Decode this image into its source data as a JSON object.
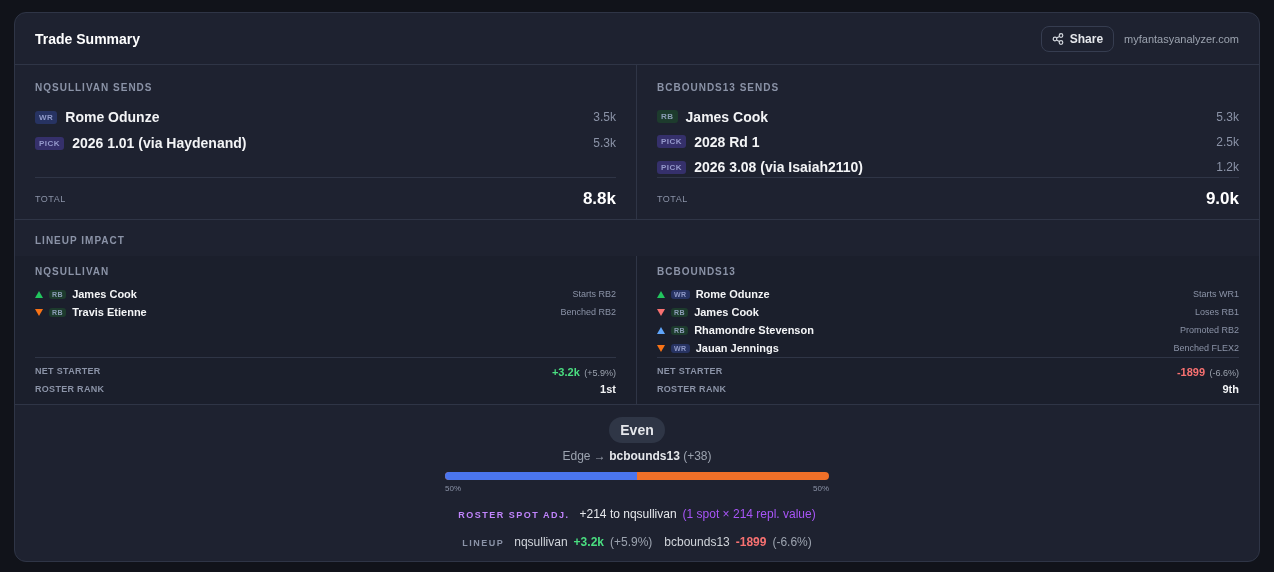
{
  "header": {
    "title": "Trade Summary",
    "share_button": "Share",
    "site": "myfantasyanalyzer.com"
  },
  "sends": [
    {
      "title": "NQSULLIVAN SENDS",
      "items": [
        {
          "tag": {
            "label": "WR",
            "color": "#273362"
          },
          "name": "Rome Odunze",
          "value": "3.5k"
        },
        {
          "tag": {
            "label": "PICK",
            "color": "#35306b"
          },
          "name": "2026 1.01 (via Haydenand)",
          "value": "5.3k"
        }
      ],
      "total_label": "TOTAL",
      "total": "8.8k"
    },
    {
      "title": "BCBOUNDS13 SENDS",
      "items": [
        {
          "tag": {
            "label": "RB",
            "color": "#1d3b2d"
          },
          "name": "James Cook",
          "value": "5.3k"
        },
        {
          "tag": {
            "label": "PICK",
            "color": "#35306b"
          },
          "name": "2028 Rd 1",
          "value": "2.5k"
        },
        {
          "tag": {
            "label": "PICK",
            "color": "#35306b"
          },
          "name": "2026 3.08 (via Isaiah2110)",
          "value": "1.2k"
        }
      ],
      "total_label": "TOTAL",
      "total": "9.0k"
    }
  ],
  "lineup_impact": {
    "title": "LINEUP IMPACT",
    "teams": [
      {
        "name": "NQSULLIVAN",
        "rows": [
          {
            "kind": "up",
            "color": "#22c55e",
            "tag": {
              "label": "RB",
              "color": "#1d3b2d"
            },
            "player": "James Cook",
            "note": "Starts RB2"
          },
          {
            "kind": "down",
            "color": "#f97316",
            "tag": {
              "label": "RB",
              "color": "#1d3b2d"
            },
            "player": "Travis Etienne",
            "note": "Benched RB2"
          }
        ],
        "net_label": "NET STARTER",
        "net": {
          "kind": "up",
          "value": "+3.2k",
          "pct": "(+5.9%)"
        },
        "rank_label": "ROSTER RANK",
        "rank": "1st"
      },
      {
        "name": "BCBOUNDS13",
        "rows": [
          {
            "kind": "up",
            "color": "#22c55e",
            "tag": {
              "label": "WR",
              "color": "#273362"
            },
            "player": "Rome Odunze",
            "note": "Starts WR1"
          },
          {
            "kind": "down",
            "color": "#f87171",
            "tag": {
              "label": "RB",
              "color": "#1d3b2d"
            },
            "player": "James Cook",
            "note": "Loses RB1"
          },
          {
            "kind": "up",
            "color": "#60a5fa",
            "tag": {
              "label": "RB",
              "color": "#1d3b2d"
            },
            "player": "Rhamondre Stevenson",
            "note": "Promoted RB2"
          },
          {
            "kind": "down",
            "color": "#f97316",
            "tag": {
              "label": "WR",
              "color": "#273362"
            },
            "player": "Jauan Jennings",
            "note": "Benched FLEX2"
          }
        ],
        "net_label": "NET STARTER",
        "net": {
          "kind": "down",
          "value": "-1899",
          "pct": "(-6.6%)"
        },
        "rank_label": "ROSTER RANK",
        "rank": "9th"
      }
    ]
  },
  "verdict": {
    "badge": "Even",
    "edge": "Edge → **bcbounds13** (+38)",
    "balance": {
      "level": 0.5,
      "left_label": "50%",
      "right_label": "50%"
    },
    "roster_spot": {
      "label": "ROSTER SPOT ADJ.",
      "value": "+214 to nqsullivan",
      "note": "(1 spot × 214 repl. value)"
    },
    "lineup": {
      "label": "LINEUP",
      "teams": [
        {
          "name": "nqsullivan",
          "kind": "up",
          "value": "+3.2k",
          "pct": "(+5.9%)"
        },
        {
          "name": "bcbounds13",
          "kind": "down",
          "value": "-1899",
          "pct": "(-6.6%)"
        }
      ]
    }
  }
}
